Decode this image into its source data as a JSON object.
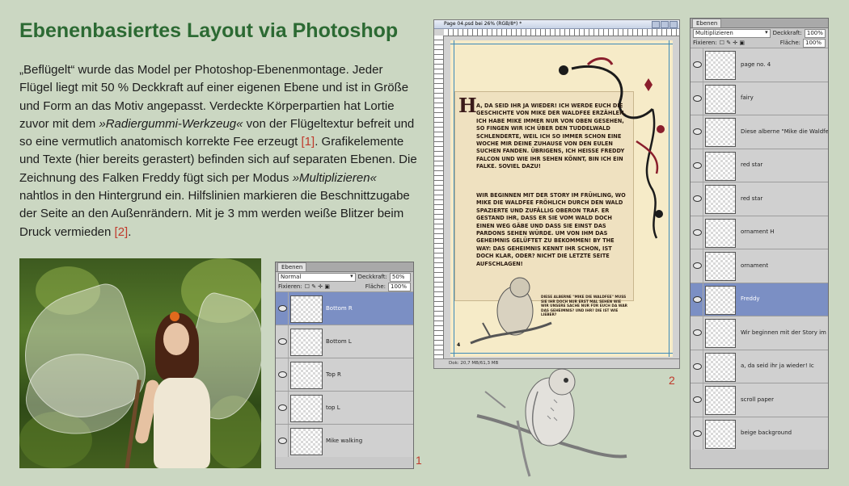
{
  "title": "Ebenenbasiertes Layout via Photoshop",
  "paragraph": {
    "p1": "„Beflügelt“ wurde das Model per Photoshop-Ebenenmontage. Jeder Flügel liegt mit 50 % Deckkraft auf einer eigenen Ebene und ist in Größe und Form an das Motiv angepasst. Verdeckte Körperpartien hat Lortie zuvor mit dem ",
    "p1_italic": "»Radiergummi-Werkzeug«",
    "p2": " von der Flügeltextur befreit und so eine vermutlich anatomisch korrekte Fee erzeugt ",
    "ref1": "[1]",
    "p3": ". Grafikelemente und Texte (hier bereits gerastert) befinden sich auf separaten Ebenen. Die Zeichnung des Falken Freddy fügt sich per Modus ",
    "p3_italic": "»Multiplizieren«",
    "p4": " nahtlos in den Hintergrund ein. Hilfslinien markieren die Beschnittzugabe der Seite an den Außenrändern. Mit je 3 mm werden weiße Blitzer beim Druck vermieden ",
    "ref2": "[2]",
    "p5": "."
  },
  "figure_numbers": {
    "one": "1",
    "two": "2"
  },
  "panel_small": {
    "tab": "Ebenen",
    "blend_mode": "Normal",
    "opacity_label": "Deckkraft:",
    "opacity_value": "50%",
    "lock_label": "Fixieren:",
    "fill_label": "Fläche:",
    "fill_value": "100%",
    "layers": [
      {
        "name": "Bottom R",
        "selected": true
      },
      {
        "name": "Bottom L",
        "selected": false
      },
      {
        "name": "Top R",
        "selected": false
      },
      {
        "name": "top L",
        "selected": false
      },
      {
        "name": "Mike walking",
        "selected": false
      }
    ]
  },
  "panel_large": {
    "tab": "Ebenen",
    "blend_mode": "Multiplizieren",
    "opacity_label": "Deckkraft:",
    "opacity_value": "100%",
    "lock_label": "Fixieren:",
    "fill_label": "Fläche:",
    "fill_value": "100%",
    "layers": [
      {
        "name": "page no. 4",
        "selected": false
      },
      {
        "name": "fairy",
        "selected": false
      },
      {
        "name": "Diese alberne \"Mike die Waldfe",
        "selected": false
      },
      {
        "name": "red star",
        "selected": false
      },
      {
        "name": "red star",
        "selected": false
      },
      {
        "name": "ornament H",
        "selected": false
      },
      {
        "name": "ornament",
        "selected": false
      },
      {
        "name": "Freddy",
        "selected": true
      },
      {
        "name": "Wir beginnen mit der Story im F",
        "selected": false
      },
      {
        "name": "a, da seid ihr ja wieder! Ic",
        "selected": false
      },
      {
        "name": "scroll paper",
        "selected": false
      },
      {
        "name": "beige background",
        "selected": false
      }
    ]
  },
  "doc_window": {
    "title": "Page 04.psd bei 26% (RGB/8*) *",
    "status": "Dok: 20,7 MB/61,3 MB",
    "dropcap": "H",
    "story1": "a, da seid ihr ja wieder! Ich werde euch die Geschichte von Mike der Waldfee erzählen. Ich habe Mike immer nur von oben gesehen, so fingen wir ich über den Tuddelwald schlenderte, weil ich so immer schon eine Woche mir deine Zuhause von den Eulen suchen fanden. Übrigens, ich heiße Freddy Falcon und wie ihr sehen könnt, bin ich ein Falke. Soviel dazu!",
    "story2": "Wir beginnen mit der Story im Frühling, wo Mike die Waldfee fröhlich durch den Wald spazierte und zufällig Oberon traf. Er gestand ihr, dass er sie vom Wald doch einen Weg gäbe und dass sie einst das Pardons sehen würde. Um von ihm das Geheimnis gelüftet zu bekommen! By the way: das Geheimnis kennt ihr schon, ist doch klar, oder? Nicht die letzte Seite aufschlagen!",
    "caption": "Diese alberne \"Mike die Waldfee\" Muss sie ihr doch nur erst mal sehen wie wir unsere Sache Nur für euch da war das Geheimnis? Und ihr? Die ist wie lieber?",
    "page_number": "4"
  },
  "colors": {
    "title": "#2c6a33",
    "background": "#cbd7c2",
    "ref": "#c0392b",
    "selected_layer": "#7b8fc4"
  }
}
